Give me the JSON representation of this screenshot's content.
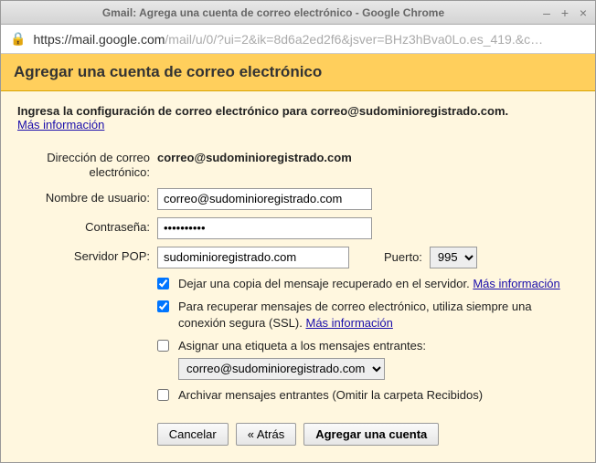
{
  "window": {
    "title": "Gmail: Agrega una cuenta de correo electrónico - Google Chrome"
  },
  "addressbar": {
    "host": "https://mail.google.com",
    "path": "/mail/u/0/?ui=2&ik=8d6a2ed2f6&jsver=BHz3hBva0Lo.es_419.&c…"
  },
  "header": {
    "title": "Agregar una cuenta de correo electrónico"
  },
  "intro": {
    "line": "Ingresa la configuración de correo electrónico para correo@sudominioregistrado.com.",
    "more_link": "Más información"
  },
  "labels": {
    "email": "Dirección de correo electrónico:",
    "username": "Nombre de usuario:",
    "password": "Contraseña:",
    "pop_server": "Servidor POP:",
    "port": "Puerto:"
  },
  "values": {
    "email": "correo@sudominioregistrado.com",
    "username": "correo@sudominioregistrado.com",
    "password": "••••••••••",
    "pop_server": "sudominioregistrado.com",
    "port": "995"
  },
  "options": {
    "leave_copy": {
      "label": "Dejar una copia del mensaje recuperado en el servidor.",
      "more": "Más información",
      "checked": true
    },
    "ssl": {
      "label": "Para recuperar mensajes de correo electrónico, utiliza siempre una conexión segura (SSL).",
      "more": "Más información",
      "checked": true
    },
    "label_incoming": {
      "label": "Asignar una etiqueta a los mensajes entrantes:",
      "select_value": "correo@sudominioregistrado.com",
      "checked": false
    },
    "archive": {
      "label": "Archivar mensajes entrantes (Omitir la carpeta Recibidos)",
      "checked": false
    }
  },
  "buttons": {
    "cancel": "Cancelar",
    "back": "« Atrás",
    "submit": "Agregar una cuenta"
  }
}
